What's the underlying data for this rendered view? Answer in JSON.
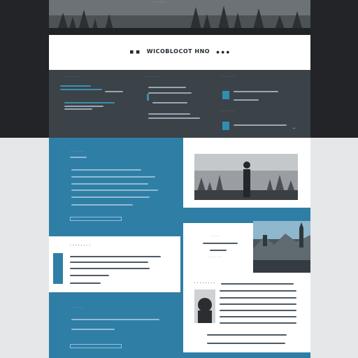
{
  "hero": {
    "banner_text": "· · · ; · ·"
  },
  "header": {
    "title": "WICOBLOCOT HNO",
    "prefix_marks": "■ ■",
    "suffix_marks": "● ● ●"
  },
  "features": {
    "col1_title": "· · · · · · · · ·",
    "col2_title": "· · · · · · · · ·",
    "col3_title": "· · · · · · · · ·",
    "col3_note": "· · · · · · · ·",
    "arrow_glyph": "→"
  },
  "blue_section": {
    "title": "· · · · · · · ·",
    "button_label": "· · · · ·"
  },
  "white_card": {
    "title": "· · · · · · · ·"
  },
  "right_text": {
    "line1": "· · · · ·",
    "line2": "· · · · · · · ·"
  },
  "article": {
    "title": "· · · · · · · ·"
  },
  "footer_blue": {
    "title": "· · · · · · · ·",
    "button_label": "· · · · ·"
  },
  "colors": {
    "dark_band": "#2a2c30",
    "nav_panel": "#3c4349",
    "blue": "#2f7fa6",
    "accent_cyan": "#3aa0c8",
    "white": "#ffffff"
  }
}
